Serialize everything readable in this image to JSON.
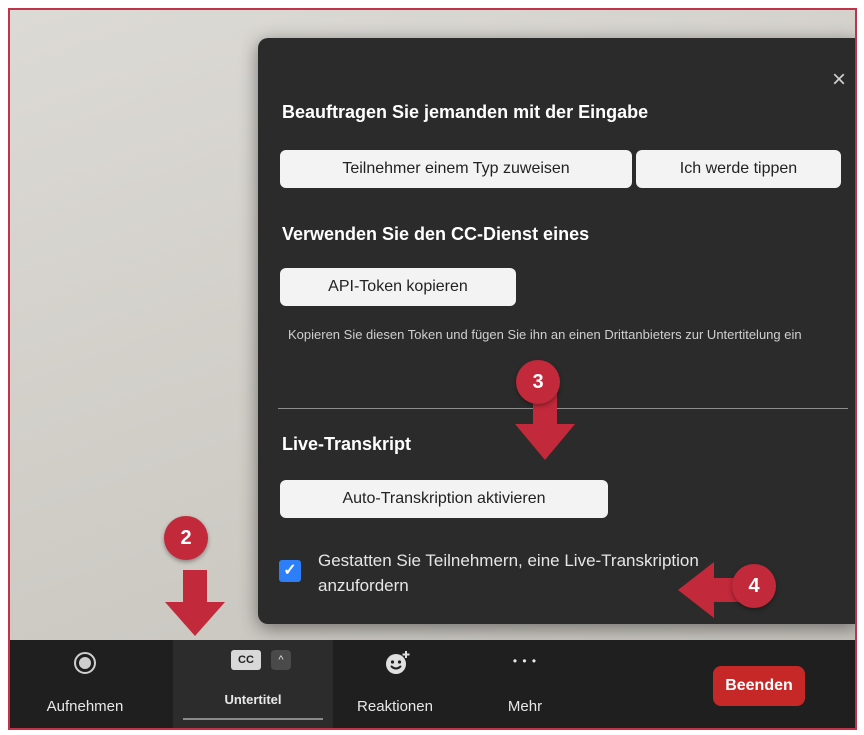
{
  "panel": {
    "close_glyph": "×",
    "section1": {
      "heading": "Beauftragen Sie jemanden mit der Eingabe",
      "assign_button": "Teilnehmer einem Typ zuweisen",
      "self_button": "Ich werde tippen"
    },
    "section2": {
      "heading": "Verwenden Sie den CC-Dienst eines",
      "copy_button": "API-Token kopieren",
      "note": "Kopieren Sie diesen Token und fügen Sie ihn an einen Drittanbieters zur Untertitelung ein"
    },
    "section3": {
      "heading": "Live-Transkript",
      "auto_button": "Auto-Transkription aktivieren",
      "checkbox_checked": true,
      "checkbox_label": "Gestatten Sie Teilnehmern, eine Live-Transkription anzufordern"
    }
  },
  "toolbar": {
    "record_label": "Aufnehmen",
    "cc_badge": "CC",
    "cc_label": "Untertitel",
    "reactions_label": "Reaktionen",
    "more_label": "Mehr",
    "more_glyph": "• • •",
    "end_label": "Beenden"
  },
  "annotations": {
    "step2": "2",
    "step3": "3",
    "step4": "4",
    "accent_color": "#c2293a"
  }
}
